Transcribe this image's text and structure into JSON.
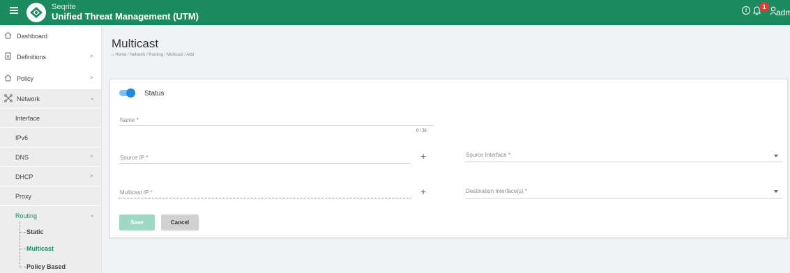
{
  "header": {
    "brand_top": "Seqrite",
    "brand_bottom": "Unified Threat Management (UTM)",
    "notification_count": "1",
    "user_label": "admi"
  },
  "sidebar": {
    "items": [
      {
        "label": "Dashboard",
        "icon": "home-icon"
      },
      {
        "label": "Definitions",
        "icon": "document-icon"
      },
      {
        "label": "Policy",
        "icon": "home-icon"
      },
      {
        "label": "Network",
        "icon": "network-icon"
      },
      {
        "label": "Interface"
      },
      {
        "label": "IPv6"
      },
      {
        "label": "DNS"
      },
      {
        "label": "DHCP"
      },
      {
        "label": "Proxy"
      },
      {
        "label": "Routing"
      }
    ],
    "routing_children": [
      "Static",
      "Multicast",
      "Policy Based"
    ]
  },
  "page": {
    "title": "Multicast",
    "breadcrumb": "Home / Network / Routing / Multicast / Add"
  },
  "form": {
    "status_label": "Status",
    "status_on": true,
    "name_label": "Name *",
    "name_counter": "0 / 32",
    "source_ip_label": "Source IP *",
    "multicast_ip_label": "Multicast IP *",
    "source_interface_label": "Source Interface *",
    "destination_interface_label": "Destination Interface(s) *",
    "save_label": "Save",
    "cancel_label": "Cancel"
  },
  "colors": {
    "brand_green": "#1c8a5f",
    "toggle_blue": "#1e88e5",
    "save_button_disabled": "#9fd9c5",
    "badge_red": "#e53935"
  }
}
